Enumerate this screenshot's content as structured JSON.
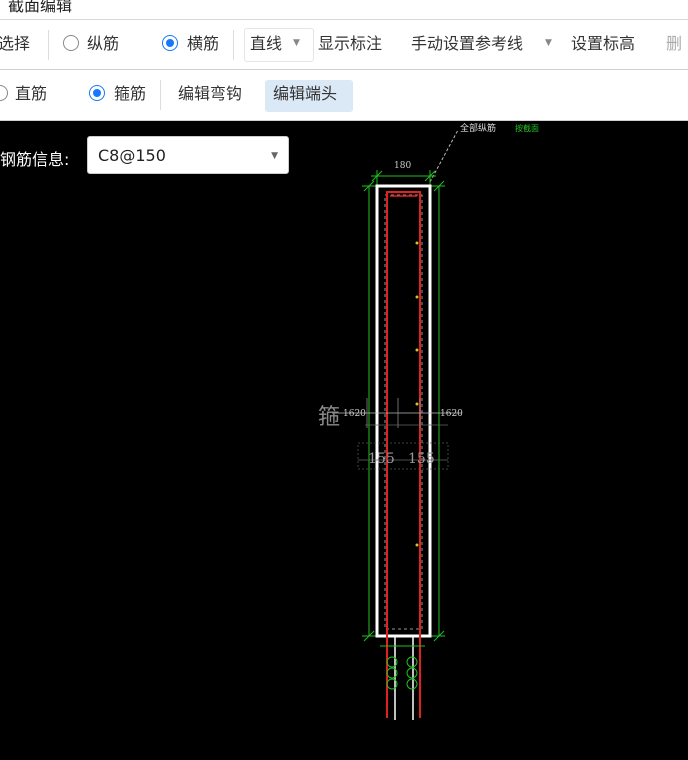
{
  "window": {
    "title": "截面编辑"
  },
  "toolbar1": {
    "select": "选择",
    "longitudinal": "纵筋",
    "transverse": "横筋",
    "line_mode": "直线",
    "show_dims": "显示标注",
    "manual_ref": "手动设置参考线",
    "set_elevation": "设置标高",
    "delete_partial": "删"
  },
  "toolbar2": {
    "straight": "直筋",
    "stirrup": "箍筋",
    "edit_hook": "编辑弯钩",
    "edit_end": "编辑端头"
  },
  "rebar_info": {
    "label": "钢筋信息:",
    "value": "C8@150"
  },
  "drawing": {
    "callout_white": "全部纵筋",
    "callout_green": "按截面",
    "top_dim": "180",
    "left_dim": "1620",
    "right_dim": "1620",
    "left_mark": "箍",
    "mid_dims": [
      "155",
      "155"
    ],
    "colors": {
      "outline": "#ffffff",
      "rebar": "#e1201f",
      "dim": "#20c020",
      "points": "#e0c020"
    }
  }
}
